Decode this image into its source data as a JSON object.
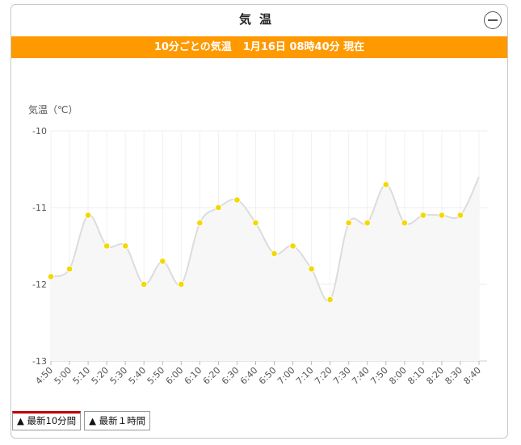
{
  "panel": {
    "title": "気温",
    "collapse_icon": "minus-circle-icon"
  },
  "banner": {
    "label": "10分ごとの気温",
    "timestamp": "1月16日 08時40分 現在",
    "color": "#ff9900"
  },
  "tabs": [
    {
      "label": "▲ 最新10分間",
      "active": true
    },
    {
      "label": "▲ 最新１時間",
      "active": false
    }
  ],
  "chart_data": {
    "type": "line",
    "ylabel": "気温（℃）",
    "xlabel": "",
    "ylim": [
      -13,
      -10
    ],
    "yticks": [
      -10,
      -11,
      -12,
      -13
    ],
    "grid": true,
    "categories": [
      "4:50",
      "5:00",
      "5:10",
      "5:20",
      "5:30",
      "5:40",
      "5:50",
      "6:00",
      "6:10",
      "6:20",
      "6:30",
      "6:40",
      "6:50",
      "7:00",
      "7:10",
      "7:20",
      "7:30",
      "7:40",
      "7:50",
      "8:00",
      "8:10",
      "8:20",
      "8:30",
      "8:40"
    ],
    "values": [
      -11.9,
      -11.8,
      -11.1,
      -11.5,
      -11.5,
      -12.0,
      -11.7,
      -12.0,
      -11.2,
      -11.0,
      -10.9,
      -11.2,
      -11.6,
      -11.5,
      -11.8,
      -12.2,
      -11.2,
      -11.2,
      -10.7,
      -11.2,
      -11.1,
      -11.1,
      -11.1,
      -10.6
    ],
    "colors": {
      "line": "#dcdcdc",
      "marker": "#f5d800",
      "area": "#f7f7f7"
    }
  }
}
